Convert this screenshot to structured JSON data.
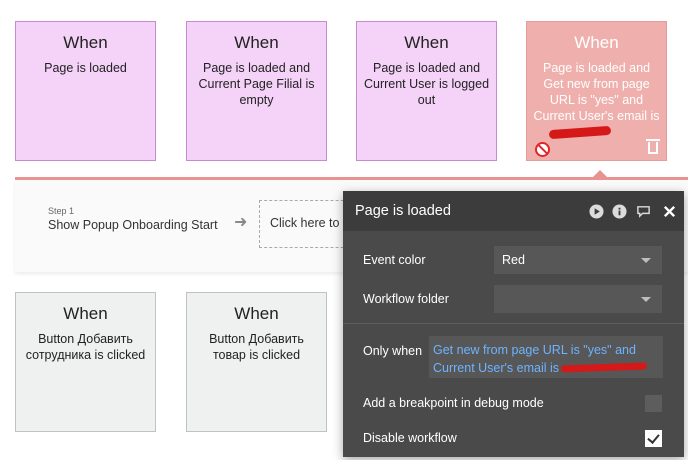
{
  "cards_top": [
    {
      "when": "When",
      "desc": "Page is loaded"
    },
    {
      "when": "When",
      "desc": "Page is loaded and Current Page Filial is empty"
    },
    {
      "when": "When",
      "desc": "Page is loaded and Current User is logged out"
    },
    {
      "when": "When",
      "desc": "Page is loaded and Get new from page URL is \"yes\" and Current User's email is"
    }
  ],
  "cards_bottom": [
    {
      "when": "When",
      "desc": "Button Добавить сотрудника is clicked"
    },
    {
      "when": "When",
      "desc": "Button Добавить товар is clicked"
    }
  ],
  "step": {
    "label": "Step 1",
    "title": "Show Popup Onboarding Start",
    "click_here": "Click here to"
  },
  "panel": {
    "title": "Page is loaded",
    "event_color_label": "Event color",
    "event_color_value": "Red",
    "workflow_folder_label": "Workflow folder",
    "workflow_folder_value": "",
    "only_when_label": "Only when",
    "only_when_value": "Get new from page URL is \"yes\" and Current User's email is",
    "breakpoint_label": "Add a breakpoint in debug mode",
    "breakpoint_checked": false,
    "disable_label": "Disable workflow",
    "disable_checked": true
  },
  "colors": {
    "event_pink": "#f5d2f8",
    "event_red": "#efb0ad",
    "event_gray": "#eef1ef",
    "panel_bg": "#4a4a4a",
    "expression_blue": "#6eb3ff"
  }
}
